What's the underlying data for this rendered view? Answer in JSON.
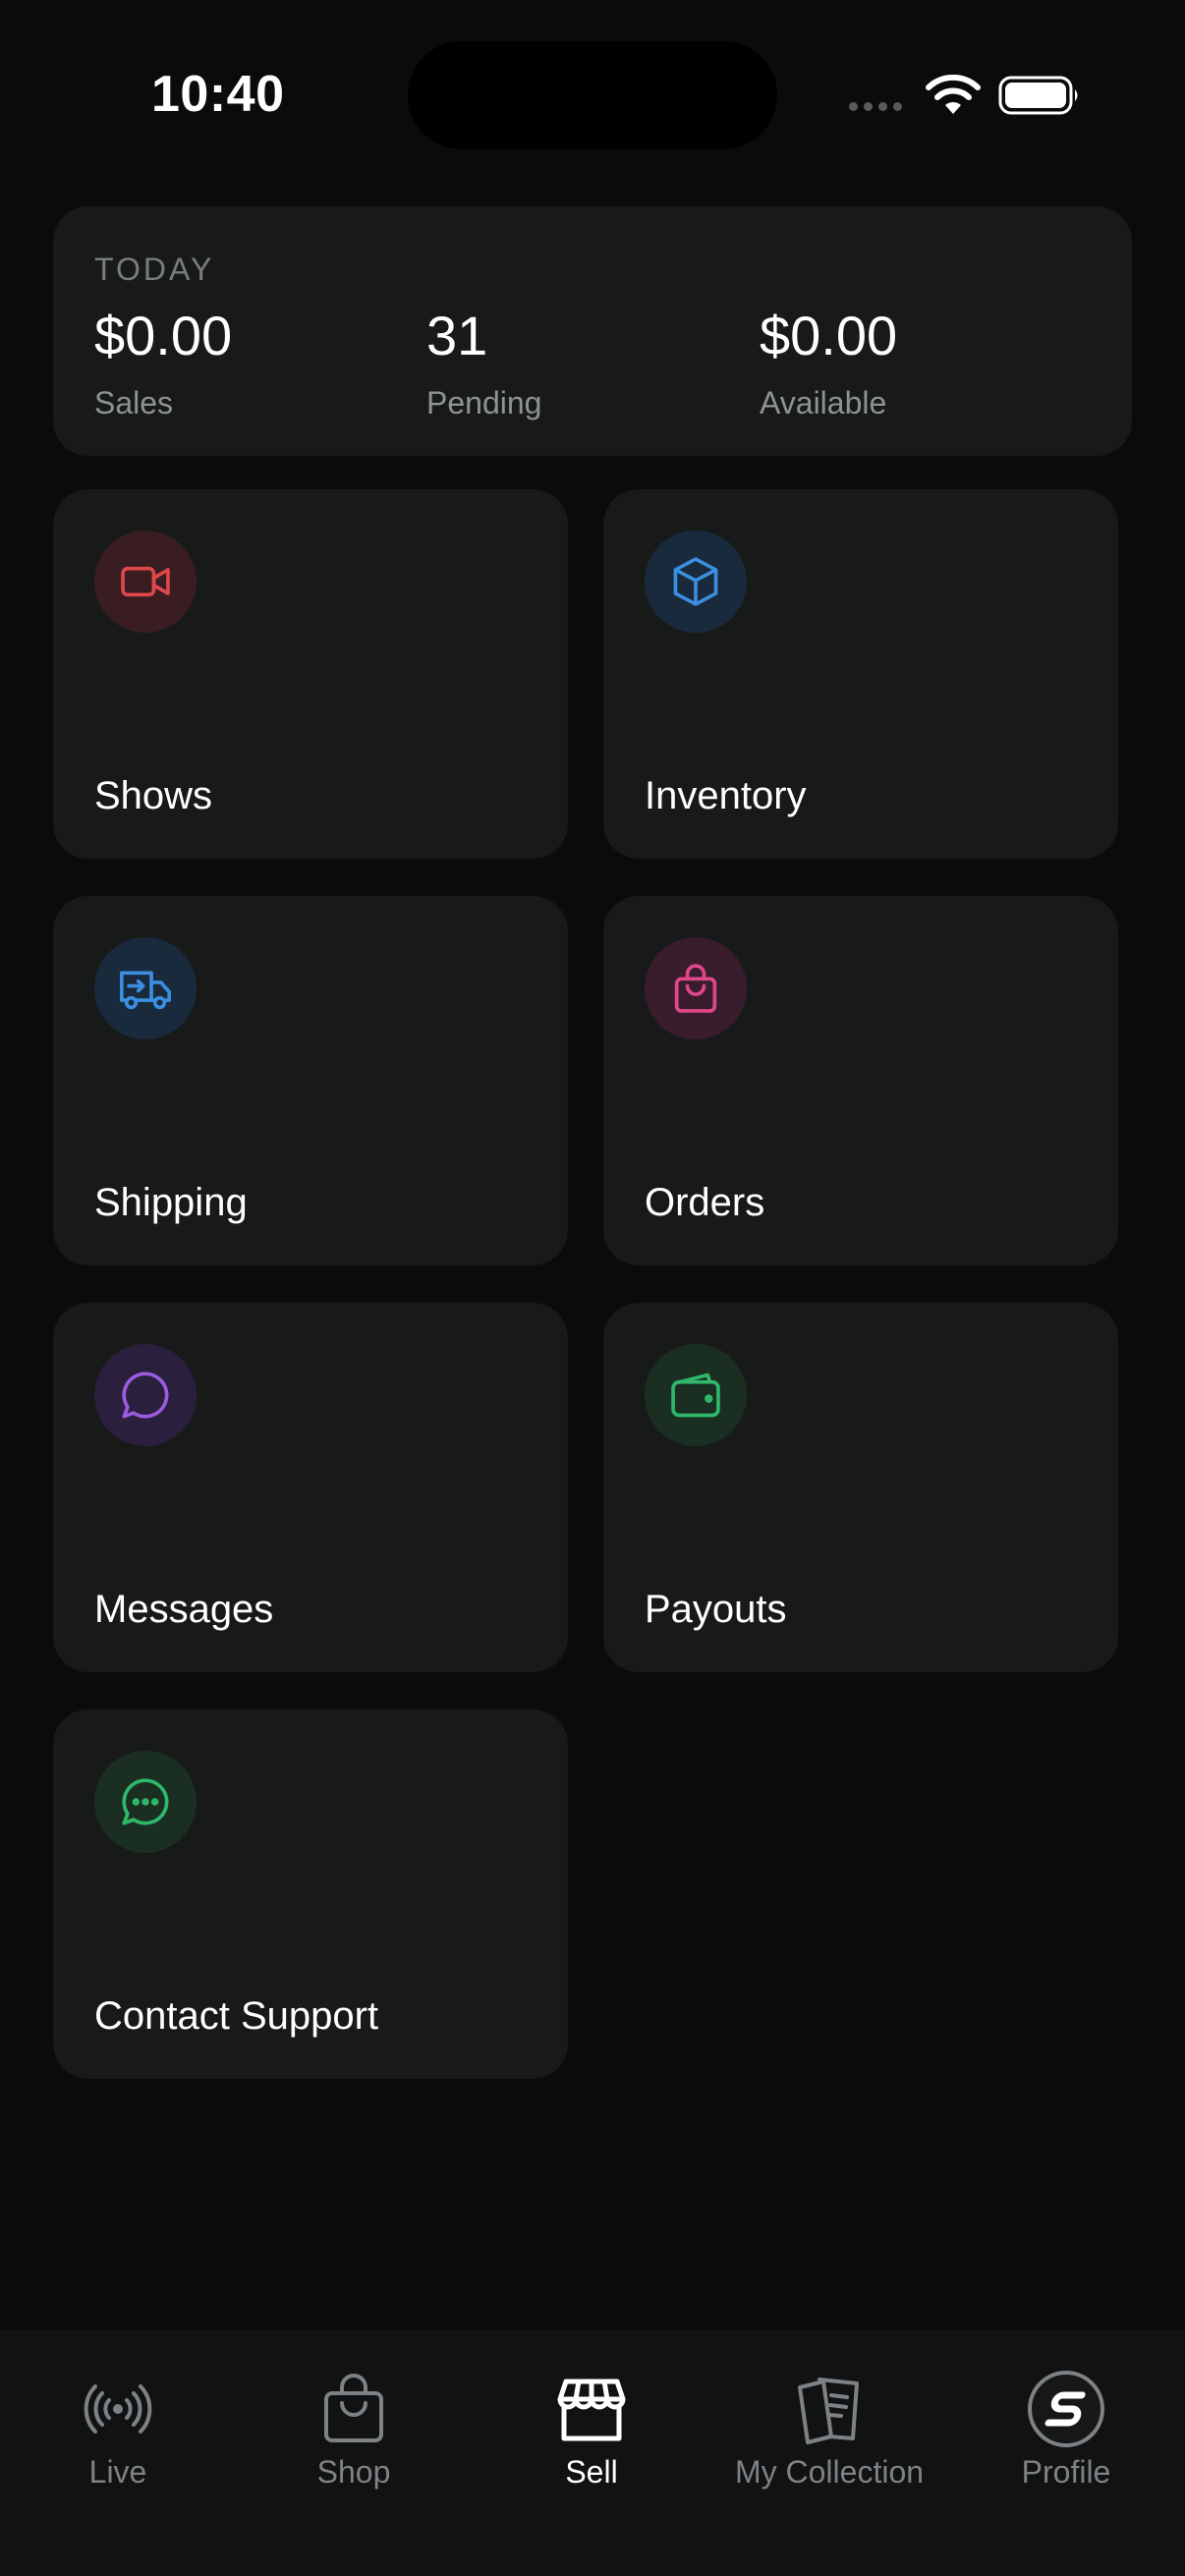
{
  "status_bar": {
    "time": "10:40"
  },
  "today": {
    "label": "TODAY",
    "stats": [
      {
        "value": "$0.00",
        "label": "Sales"
      },
      {
        "value": "31",
        "label": "Pending"
      },
      {
        "value": "$0.00",
        "label": "Available"
      }
    ]
  },
  "tiles": [
    {
      "label": "Shows",
      "icon": "video-camera-icon",
      "color": "#e0474c",
      "bg": "#3a1d20"
    },
    {
      "label": "Inventory",
      "icon": "box-icon",
      "color": "#3b8fe0",
      "bg": "#1a2a3d"
    },
    {
      "label": "Shipping",
      "icon": "truck-icon",
      "color": "#3b8fe0",
      "bg": "#1a2a3d"
    },
    {
      "label": "Orders",
      "icon": "shopping-bag-icon",
      "color": "#e0478a",
      "bg": "#3a1d2c"
    },
    {
      "label": "Messages",
      "icon": "chat-bubble-icon",
      "color": "#9a5ce0",
      "bg": "#2a1f3d"
    },
    {
      "label": "Payouts",
      "icon": "wallet-icon",
      "color": "#2fb86a",
      "bg": "#1a2f22"
    },
    {
      "label": "Contact Support",
      "icon": "support-chat-icon",
      "color": "#2fb86a",
      "bg": "#1a2f22"
    }
  ],
  "nav": {
    "items": [
      {
        "label": "Live",
        "icon": "broadcast-icon"
      },
      {
        "label": "Shop",
        "icon": "shop-bag-icon"
      },
      {
        "label": "Sell",
        "icon": "storefront-icon",
        "active": true
      },
      {
        "label": "My Collection",
        "icon": "cards-icon"
      },
      {
        "label": "Profile",
        "icon": "profile-logo-icon"
      }
    ]
  }
}
